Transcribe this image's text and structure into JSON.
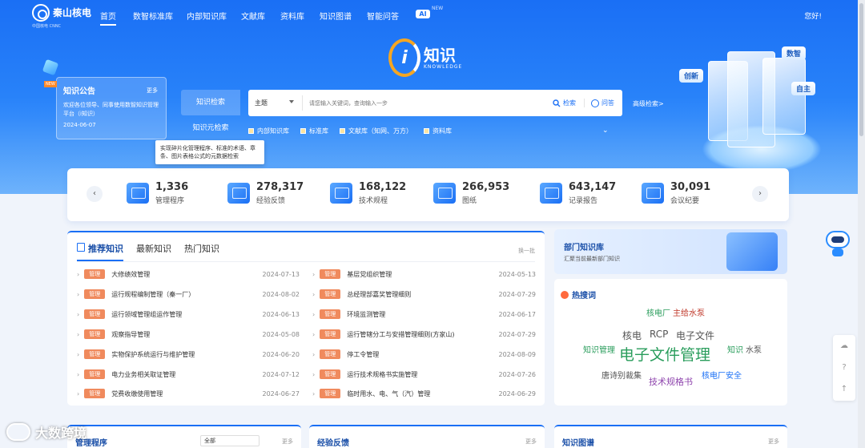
{
  "nav": {
    "logo_name": "秦山核电",
    "logo_sub": "中国核电 CNNC",
    "items": [
      "首页",
      "数智标准库",
      "内部知识库",
      "文献库",
      "资料库",
      "知识图谱",
      "智能问答"
    ],
    "ai_label": "AI",
    "ai_new": "NEW",
    "greeting": "您好!"
  },
  "brand": {
    "glyph": "i",
    "name": "知识",
    "en": "KNOWLEDGE"
  },
  "notice": {
    "badge": "NEW",
    "title": "知识公告",
    "more": "更多",
    "body": "欢迎各位领导、同事使用数智知识管理平台（i知识）",
    "date": "2024-06-07"
  },
  "search": {
    "tabs": [
      "知识检索",
      "知识元检索"
    ],
    "select": "主题",
    "placeholder": "请您输入关键词，查询输入一步",
    "search_label": "检索",
    "ask_label": "问答",
    "advanced": "高级检索>",
    "filters": [
      "内部知识库",
      "标准库",
      "文献库（知网、万方）",
      "资料库"
    ],
    "tooltip": "实现碎片化管理程序、标准的术语、章条、图片表格公式的元数据检索"
  },
  "illustration": {
    "tags": [
      "数智",
      "创新",
      "自主"
    ]
  },
  "stats": [
    {
      "value": "1,336",
      "label": "管理程序"
    },
    {
      "value": "278,317",
      "label": "经验反馈"
    },
    {
      "value": "168,122",
      "label": "技术规程"
    },
    {
      "value": "266,953",
      "label": "图纸"
    },
    {
      "value": "643,147",
      "label": "记录报告"
    },
    {
      "value": "30,091",
      "label": "会议纪要"
    }
  ],
  "recommend": {
    "tabs": [
      "推荐知识",
      "最新知识",
      "热门知识"
    ],
    "refresh": "换一批",
    "left": [
      {
        "badge": "管理",
        "title": "大修绩效管理",
        "date": "2024-07-13"
      },
      {
        "badge": "管理",
        "title": "运行规程编制管理（秦一厂）",
        "date": "2024-08-02"
      },
      {
        "badge": "管理",
        "title": "运行领域管理组运作管理",
        "date": "2024-06-13"
      },
      {
        "badge": "管理",
        "title": "观察指导管理",
        "date": "2024-05-08"
      },
      {
        "badge": "管理",
        "title": "实物保护系统运行与维护管理",
        "date": "2024-06-20"
      },
      {
        "badge": "管理",
        "title": "电力业务相关取证管理",
        "date": "2024-07-12"
      },
      {
        "badge": "管理",
        "title": "党费收缴使用管理",
        "date": "2024-06-27"
      }
    ],
    "right": [
      {
        "badge": "管理",
        "title": "基层党组织管理",
        "date": "2024-05-13"
      },
      {
        "badge": "管理",
        "title": "总经理部嘉奖管理细则",
        "date": "2024-07-29"
      },
      {
        "badge": "管理",
        "title": "环境监测管理",
        "date": "2024-06-17"
      },
      {
        "badge": "管理",
        "title": "运行管辖分工与安措管理细则(方家山)",
        "date": "2024-07-29"
      },
      {
        "badge": "管理",
        "title": "停工令管理",
        "date": "2024-08-09"
      },
      {
        "badge": "管理",
        "title": "运行技术规格书实施管理",
        "date": "2024-07-26"
      },
      {
        "badge": "管理",
        "title": "临时用水、电、气（汽）管理",
        "date": "2024-06-29"
      }
    ]
  },
  "dept": {
    "title": "部门知识库",
    "subtitle": "汇聚当前最新部门知识"
  },
  "hot": {
    "title": "热搜词",
    "words": [
      "核电厂",
      "主给水泵",
      "核电",
      "RCP",
      "电子文件",
      "知识管理",
      "电子文件管理",
      "知识",
      "水泵",
      "唐诗别裁集",
      "技术规格书",
      "核电厂安全"
    ]
  },
  "bottom": {
    "cards": [
      {
        "title": "管理程序",
        "more": "更多",
        "select": "全部"
      },
      {
        "title": "经验反馈",
        "more": "更多"
      },
      {
        "title": "知识图谱",
        "more": "更多"
      }
    ]
  },
  "side_tools": [
    "☁",
    "?",
    "↑"
  ],
  "watermark": "大数跨境",
  "colors": {
    "primary": "#1a6ff5",
    "badge": "#f08a5d",
    "accent": "#f5a623"
  }
}
